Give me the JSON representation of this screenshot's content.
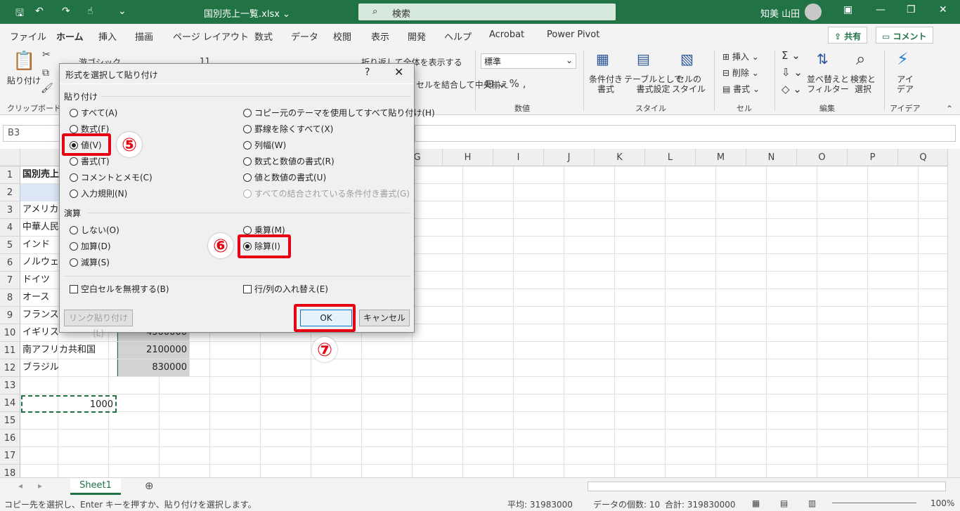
{
  "titlebar": {
    "doc_title": "国別売上一覧.xlsx  ⌄",
    "search_placeholder": "検索",
    "user_name": "知美 山田"
  },
  "tabs": [
    "ファイル",
    "ホーム",
    "挿入",
    "描画",
    "ページ レイアウト",
    "数式",
    "データ",
    "校閲",
    "表示",
    "開発",
    "ヘルプ",
    "Acrobat",
    "Power Pivot"
  ],
  "share_label": "共有",
  "comment_label": "コメント",
  "ribbon": {
    "paste_label": "貼り付け",
    "clipboard_label": "クリップボード",
    "font_name": "游ゴシック",
    "font_size": "11",
    "wrap_text": "折り返して全体を表示する",
    "merge_center": "セルを結合して中央揃え",
    "number_format": "標準",
    "number_label": "数値",
    "cond_format": "条件付き\n書式",
    "table_format": "テーブルとして\n書式設定",
    "cell_style": "セルの\nスタイル",
    "style_label": "スタイル",
    "insert": "挿入",
    "delete": "削除",
    "format": "書式",
    "cell_label": "セル",
    "sort_filter": "並べ替えと\nフィルター",
    "find_select": "検索と\n選択",
    "edit_label": "編集",
    "ideas": "アイ\nデア",
    "ideas_label": "アイデア"
  },
  "namebox": "B3",
  "columns": [
    "G",
    "H",
    "I",
    "J",
    "K",
    "L",
    "M",
    "N",
    "O",
    "P",
    "Q"
  ],
  "rows": [
    "1",
    "2",
    "3",
    "4",
    "5",
    "6",
    "7",
    "8",
    "9",
    "10",
    "11",
    "12",
    "13",
    "14",
    "15",
    "16",
    "17",
    "18"
  ],
  "cells": {
    "a1": "国別売上",
    "a3": "アメリカ",
    "a4": "中華人民",
    "a5": "インド",
    "a6": "ノルウェ",
    "a7": "ドイツ",
    "a8": "オース",
    "a9": "フランス",
    "a10": "イギリス",
    "b10": "4500000",
    "a11": "南アフリカ共和国",
    "b11": "2100000",
    "a12": "ブラジル",
    "b12": "830000",
    "a14": "1000"
  },
  "sheet_name": "Sheet1",
  "status": {
    "message": "コピー先を選択し、Enter キーを押すか、貼り付けを選択します。",
    "average": "平均: 31983000",
    "count": "データの個数: 10",
    "sum": "合計: 319830000",
    "zoom": "100%"
  },
  "dialog": {
    "title": "形式を選択して貼り付け",
    "help": "?",
    "paste_section": "貼り付け",
    "paste_left": [
      "すべて(A)",
      "数式(F)",
      "値(V)",
      "書式(T)",
      "コメントとメモ(C)",
      "入力規則(N)"
    ],
    "paste_right": [
      "コピー元のテーマを使用してすべて貼り付け(H)",
      "罫線を除くすべて(X)",
      "列幅(W)",
      "数式と数値の書式(R)",
      "値と数値の書式(U)",
      "すべての結合されている条件付き書式(G)"
    ],
    "op_section": "演算",
    "op_left": [
      "しない(O)",
      "加算(D)",
      "減算(S)"
    ],
    "op_right": [
      "乗算(M)",
      "除算(I)"
    ],
    "skip_blanks": "空白セルを無視する(B)",
    "transpose": "行/列の入れ替え(E)",
    "paste_link": "リンク貼り付け(L)",
    "ok": "OK",
    "cancel": "キャンセル"
  },
  "markers": [
    "⑤",
    "⑥",
    "⑦"
  ]
}
